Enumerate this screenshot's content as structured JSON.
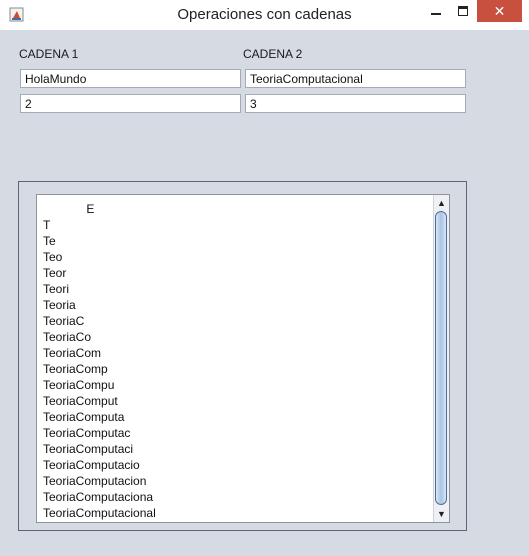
{
  "window": {
    "title": "Operaciones con cadenas",
    "close_glyph": "✕"
  },
  "form": {
    "cadena1": {
      "label": "CADENA 1",
      "value": "HolaMundo",
      "index": "2"
    },
    "cadena2": {
      "label": "CADENA 2",
      "value": "TeoriaComputacional",
      "index": "3"
    }
  },
  "output": {
    "lines": [
      "             E",
      "T",
      "Te",
      "Teo",
      "Teor",
      "Teori",
      "Teoria",
      "TeoriaC",
      "TeoriaCo",
      "TeoriaCom",
      "TeoriaComp",
      "TeoriaCompu",
      "TeoriaComput",
      "TeoriaComputa",
      "TeoriaComputac",
      "TeoriaComputaci",
      "TeoriaComputacio",
      "TeoriaComputacion",
      "TeoriaComputaciona",
      "TeoriaComputacional"
    ]
  },
  "icons": {
    "up": "▲",
    "down": "▼"
  }
}
